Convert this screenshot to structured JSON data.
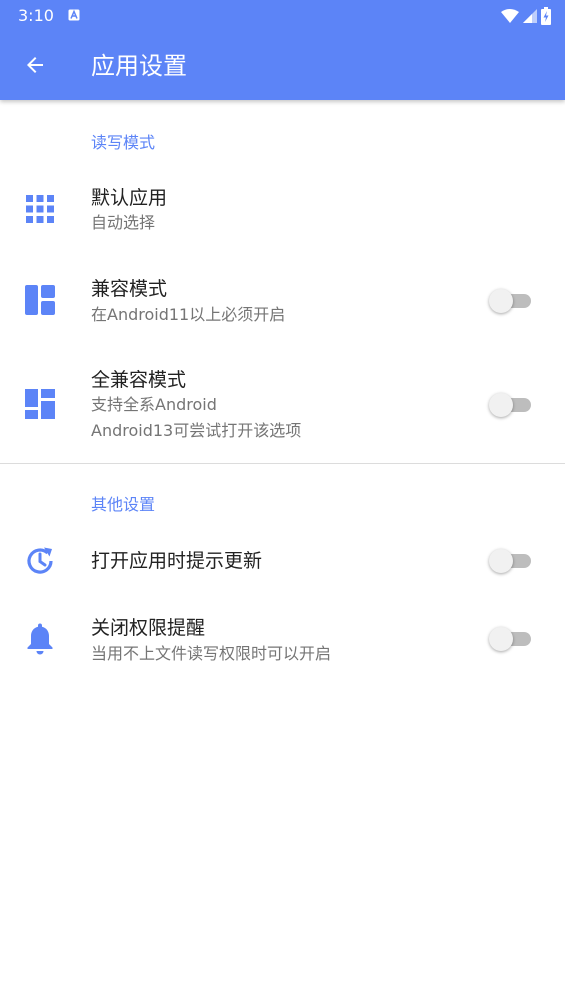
{
  "status_bar": {
    "time": "3:10",
    "notification_icon": "a-letter-icon",
    "icons": [
      "wifi-icon",
      "signal-icon",
      "battery-charging-icon"
    ]
  },
  "app_bar": {
    "title": "应用设置",
    "back_icon": "arrow-left-icon",
    "color": "#5c84f7"
  },
  "sections": {
    "rw_mode": {
      "header": "读写模式",
      "items": [
        {
          "icon": "grid-apps-icon",
          "title": "默认应用",
          "summary": "自动选择"
        },
        {
          "icon": "dashboard-layout-icon",
          "title": "兼容模式",
          "summary": "在Android11以上必须开启",
          "switch_on": false
        },
        {
          "icon": "dashboard-alt-icon",
          "title": "全兼容模式",
          "summary_line1": "支持全系Android",
          "summary_line2": "Android13可尝试打开该选项",
          "switch_on": false
        }
      ]
    },
    "other": {
      "header": "其他设置",
      "items": [
        {
          "icon": "update-clock-icon",
          "title": "打开应用时提示更新",
          "switch_on": false
        },
        {
          "icon": "bell-icon",
          "title": "关闭权限提醒",
          "summary": "当用不上文件读写权限时可以开启",
          "switch_on": false
        }
      ]
    }
  },
  "colors": {
    "accent": "#5c84f7",
    "title_text": "#222222",
    "summary_text": "#757575"
  }
}
